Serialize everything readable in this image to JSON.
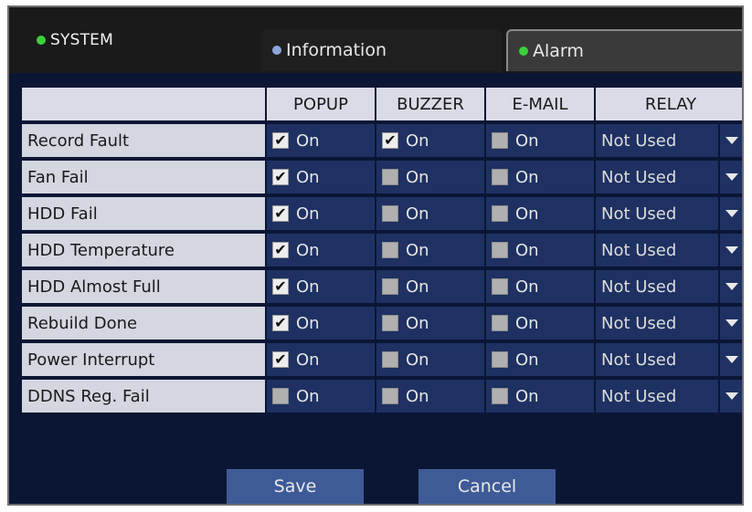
{
  "header": {
    "system_label": "SYSTEM",
    "system_led_color": "#3cd13c"
  },
  "tabs": [
    {
      "label": "Information",
      "led_color": "#8fa6d8",
      "active": false
    },
    {
      "label": "Alarm",
      "led_color": "#3cd13c",
      "active": true
    }
  ],
  "table": {
    "columns": [
      "POPUP",
      "BUZZER",
      "E-MAIL",
      "RELAY"
    ],
    "checkbox_label": "On",
    "rows": [
      {
        "name": "Record Fault",
        "popup": true,
        "buzzer": true,
        "email": false,
        "relay": "Not Used"
      },
      {
        "name": "Fan Fail",
        "popup": true,
        "buzzer": false,
        "email": false,
        "relay": "Not Used"
      },
      {
        "name": "HDD Fail",
        "popup": true,
        "buzzer": false,
        "email": false,
        "relay": "Not Used"
      },
      {
        "name": "HDD Temperature",
        "popup": true,
        "buzzer": false,
        "email": false,
        "relay": "Not Used"
      },
      {
        "name": "HDD Almost Full",
        "popup": true,
        "buzzer": false,
        "email": false,
        "relay": "Not Used"
      },
      {
        "name": "Rebuild Done",
        "popup": true,
        "buzzer": false,
        "email": false,
        "relay": "Not Used"
      },
      {
        "name": "Power Interrupt",
        "popup": true,
        "buzzer": false,
        "email": false,
        "relay": "Not Used"
      },
      {
        "name": "DDNS Reg. Fail",
        "popup": false,
        "buzzer": false,
        "email": false,
        "relay": "Not Used"
      }
    ]
  },
  "buttons": {
    "save_label": "Save",
    "cancel_label": "Cancel"
  }
}
